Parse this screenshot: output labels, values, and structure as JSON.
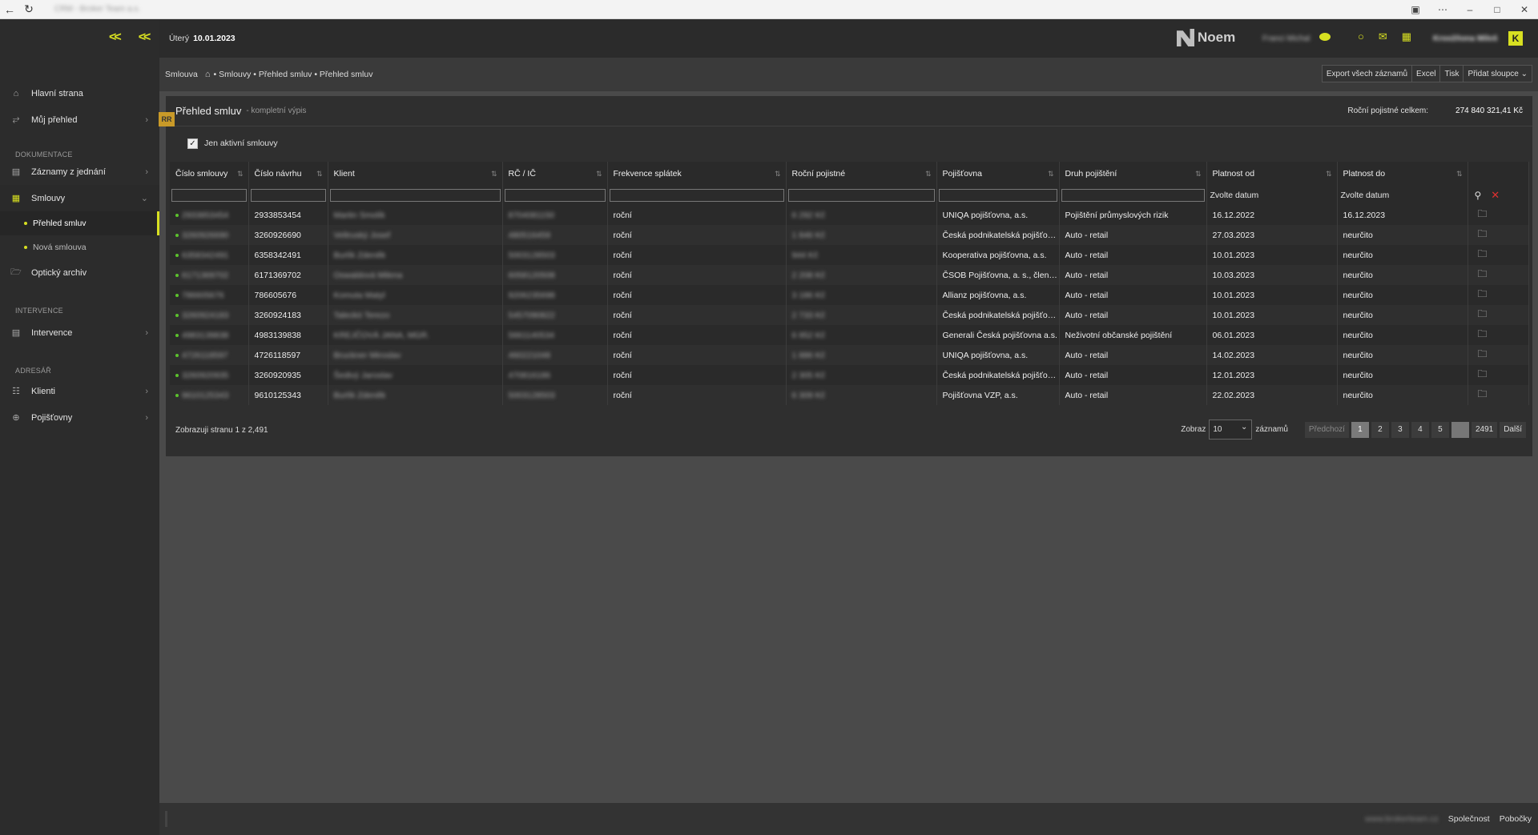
{
  "browser": {
    "title": "CRM - Broker Team a.s."
  },
  "header": {
    "day": "Úterý",
    "date": "10.01.2023",
    "logo": "Noem",
    "user": "Franci Michal",
    "company": "Kroožňona Miloš",
    "avatar_letter": "K"
  },
  "sidebar": {
    "items": [
      {
        "label": "Hlavní strana"
      },
      {
        "label": "Můj přehled"
      }
    ],
    "section_docs": "DOKUMENTACE",
    "docs": [
      {
        "label": "Záznamy z jednání"
      },
      {
        "label": "Smlouvy"
      }
    ],
    "subitems": [
      {
        "label": "Přehled smluv"
      },
      {
        "label": "Nová smlouva"
      }
    ],
    "archive": "Optický archiv",
    "section_interv": "INTERVENCE",
    "intervence": "Intervence",
    "section_adresar": "ADRESÁŘ",
    "klienti": "Klienti",
    "pojistovny": "Pojišťovny"
  },
  "breadcrumb": {
    "root": "Smlouva",
    "path": "• Smlouvy • Přehled smluv • Přehled smluv"
  },
  "actions": {
    "export": "Export všech záznamů",
    "excel": "Excel",
    "tisk": "Tisk",
    "add_columns": "Přidat sloupce"
  },
  "panel": {
    "badge": "RR",
    "title": "Přehled smluv",
    "subtitle": "- kompletní výpis",
    "total_label": "Roční pojistné celkem:",
    "total_value": "274 840 321,41 Kč",
    "active_only": "Jen aktivní smlouvy"
  },
  "table": {
    "columns": [
      "Číslo smlouvy",
      "Číslo návrhu",
      "Klient",
      "RČ / IČ",
      "Frekvence splátek",
      "Roční pojistné",
      "Pojišťovna",
      "Druh pojištění",
      "Platnost od",
      "Platnost do"
    ],
    "date_placeholder": "Zvolte datum",
    "rows": [
      {
        "cislo": "2933853454",
        "navrh": "2933853454",
        "klient": "Martin Smolík",
        "rc": "8704081150",
        "frekvence": "roční",
        "pojistne": "6 292 Kč",
        "pojistovna": "UNIQA pojišťovna, a.s.",
        "druh": "Pojištění průmyslových rizik",
        "od": "16.12.2022",
        "do": "16.12.2023"
      },
      {
        "cislo": "3260926690",
        "navrh": "3260926690",
        "klient": "Veltruský Josef",
        "rc": "480516459",
        "frekvence": "roční",
        "pojistne": "1 846 Kč",
        "pojistovna": "Česká podnikatelská pojišťovna",
        "druh": "Auto - retail",
        "od": "27.03.2023",
        "do": "neurčito"
      },
      {
        "cislo": "6358342491",
        "navrh": "6358342491",
        "klient": "Burlík Zdeněk",
        "rc": "5003128503",
        "frekvence": "roční",
        "pojistne": "944 Kč",
        "pojistovna": "Kooperativa pojišťovna, a.s.",
        "druh": "Auto - retail",
        "od": "10.01.2023",
        "do": "neurčito"
      },
      {
        "cislo": "6171369702",
        "navrh": "6171369702",
        "klient": "Oswaldová Milena",
        "rc": "6058120508",
        "frekvence": "roční",
        "pojistne": "2 208 Kč",
        "pojistovna": "ČSOB Pojišťovna, a. s., člen holdingu ČSOB",
        "druh": "Auto - retail",
        "od": "10.03.2023",
        "do": "neurčito"
      },
      {
        "cislo": "786605676",
        "navrh": "786605676",
        "klient": "Komuta Matyl",
        "rc": "9206235698",
        "frekvence": "roční",
        "pojistne": "3 186 Kč",
        "pojistovna": "Allianz pojišťovna, a.s.",
        "druh": "Auto - retail",
        "od": "10.01.2023",
        "do": "neurčito"
      },
      {
        "cislo": "3260924183",
        "navrh": "3260924183",
        "klient": "Taleckö Terezo",
        "rc": "5457090822",
        "frekvence": "roční",
        "pojistne": "2 733 Kč",
        "pojistovna": "Česká podnikatelská pojišťovna",
        "druh": "Auto - retail",
        "od": "10.01.2023",
        "do": "neurčito"
      },
      {
        "cislo": "4983139838",
        "navrh": "4983139838",
        "klient": "KREJČOVÁ JANA, MGR.",
        "rc": "5661140534",
        "frekvence": "roční",
        "pojistne": "6 952 Kč",
        "pojistovna": "Generali Česká pojišťovna a.s.",
        "druh": "Neživotní občanské pojištění",
        "od": "06.01.2023",
        "do": "neurčito"
      },
      {
        "cislo": "4726118597",
        "navrh": "4726118597",
        "klient": "Bruckner Miroslav",
        "rc": "460221048",
        "frekvence": "roční",
        "pojistne": "1 886 Kč",
        "pojistovna": "UNIQA pojišťovna, a.s.",
        "druh": "Auto - retail",
        "od": "14.02.2023",
        "do": "neurčito"
      },
      {
        "cislo": "3260920935",
        "navrh": "3260920935",
        "klient": "Šedivý Jaroslav",
        "rc": "470816186",
        "frekvence": "roční",
        "pojistne": "2 305 Kč",
        "pojistovna": "Česká podnikatelská pojišťovna",
        "druh": "Auto - retail",
        "od": "12.01.2023",
        "do": "neurčito"
      },
      {
        "cislo": "9610125343",
        "navrh": "9610125343",
        "klient": "Burlík Zdeněk",
        "rc": "5003128503",
        "frekvence": "roční",
        "pojistne": "6 309 Kč",
        "pojistovna": "Pojišťovna VZP, a.s.",
        "druh": "Auto - retail",
        "od": "22.02.2023",
        "do": "neurčito"
      }
    ]
  },
  "pagination": {
    "info": "Zobrazuji stranu 1 z 2,491",
    "show_label": "Zobraz",
    "page_size": "10",
    "records_label": "záznamů",
    "prev": "Předchozí",
    "pages": [
      "1",
      "2",
      "3",
      "4",
      "5"
    ],
    "last": "2491",
    "next": "Další"
  },
  "footer": {
    "site": "www.brokerteam.cz",
    "company": "Společnost",
    "branches": "Pobočky"
  }
}
